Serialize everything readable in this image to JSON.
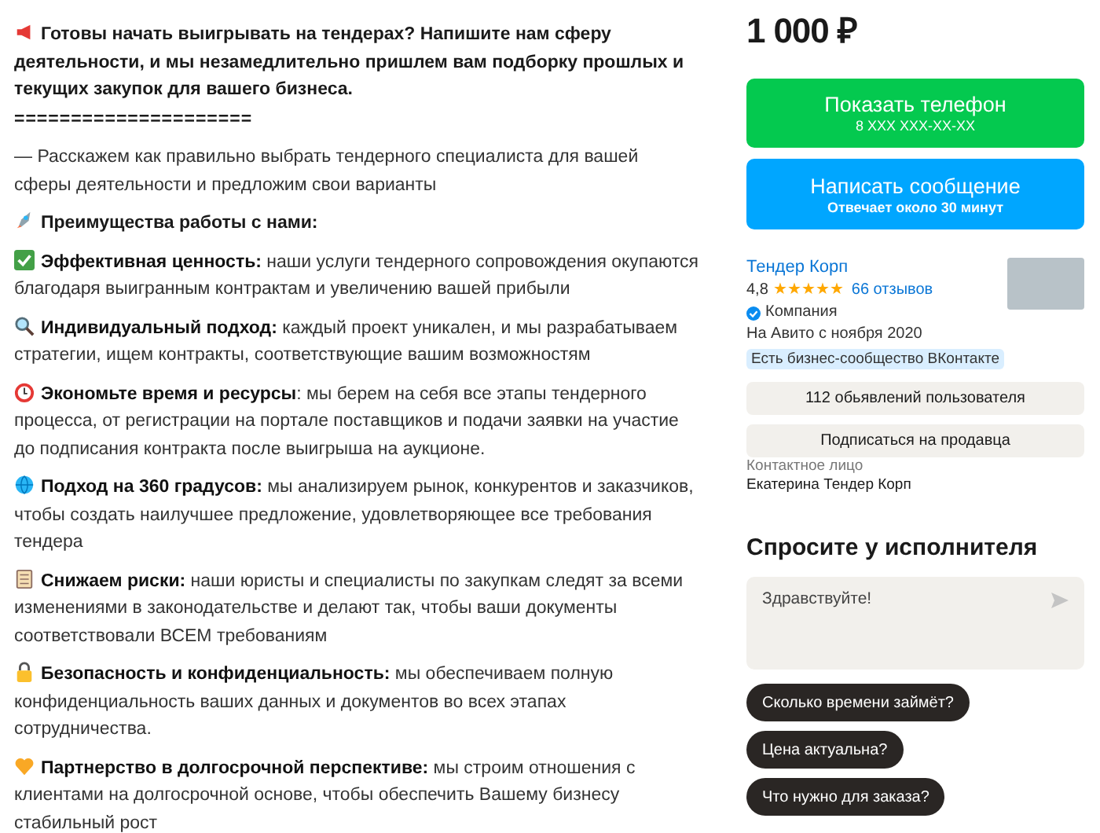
{
  "description": [
    {
      "kind": "heading",
      "text": "Готовы начать выигрывать на тендерах? Напишите нам сферу деятельности, и мы незамедлительно пришлем вам подборку прошлых и текущих закупок для вашего бизнеса."
    },
    {
      "kind": "divider",
      "text": "====================="
    },
    {
      "kind": "text",
      "text": "— Расскажем как правильно выбрать тендерного специалиста для вашей сферы деятельности и предложим свои варианты"
    },
    {
      "kind": "heading",
      "text": "Преимущества работы с нами:"
    },
    {
      "kind": "feature",
      "text": "**Эффективная ценность:** наши услуги тендерного сопровождения окупаются благодаря выигранным контрактам и увеличению вашей прибыли"
    },
    {
      "kind": "feature",
      "text": "**Индивидуальный подход:** каждый проект уникален, и мы разрабатываем стратегии, ищем контракты, соответствующие вашим возможностям"
    },
    {
      "kind": "feature",
      "text": "**Экономьте время и ресурсы**: мы берем на себя все этапы тендерного процесса, от регистрации на портале поставщиков и подачи заявки на участие до подписания контракта после выигрыша на аукционе."
    },
    {
      "kind": "feature",
      "text": "**Подход на 360 градусов:** мы анализируем рынок, конкурентов и заказчиков, чтобы создать наилучшее предложение, удовлетворяющее все требования тендера"
    },
    {
      "kind": "feature",
      "text": "**Снижаем риски:** наши юристы и специалисты по закупкам следят за всеми изменениями в законодательстве и делают так, чтобы ваши документы соответствовали ВСЕМ требованиям"
    },
    {
      "kind": "feature",
      "text": "**Безопасность и конфиденциальность:** мы обеспечиваем полную конфиденциальность ваших данных и документов во всех этапах сотрудничества."
    },
    {
      "kind": "feature",
      "text": "**Партнерство в долгосрочной перспективе:** мы строим отношения с клиентами на долгосрочной основе, чтобы обеспечить Вашему бизнесу стабильный рост"
    }
  ],
  "price": "1 000 ₽",
  "phone_button": {
    "label": "Показать телефон",
    "sublabel": "8 XXX XXX-XX-XX"
  },
  "message_button": {
    "label": "Написать сообщение",
    "sublabel": "Отвечает около 30 минут"
  },
  "seller": {
    "name": "Тендер Корп",
    "rating": "4,8",
    "stars": 5,
    "reviews": "66 отзывов",
    "verified": true,
    "type": "Компания",
    "since": "На Авито с ноября 2020",
    "badge": "Есть бизнес-сообщество ВКонтакте"
  },
  "listings_button": "112 обьявлений пользователя",
  "subscribe_button": "Подписаться на продавца",
  "contact": {
    "label": "Контактное лицо",
    "name": "Екатерина Тендер Корп"
  },
  "ask": {
    "title": "Спросите у исполнителя",
    "placeholder": "Здравствуйте!",
    "suggestions": [
      "Сколько времени займёт?",
      "Цена актуальна?",
      "Что нужно для заказа?"
    ]
  }
}
